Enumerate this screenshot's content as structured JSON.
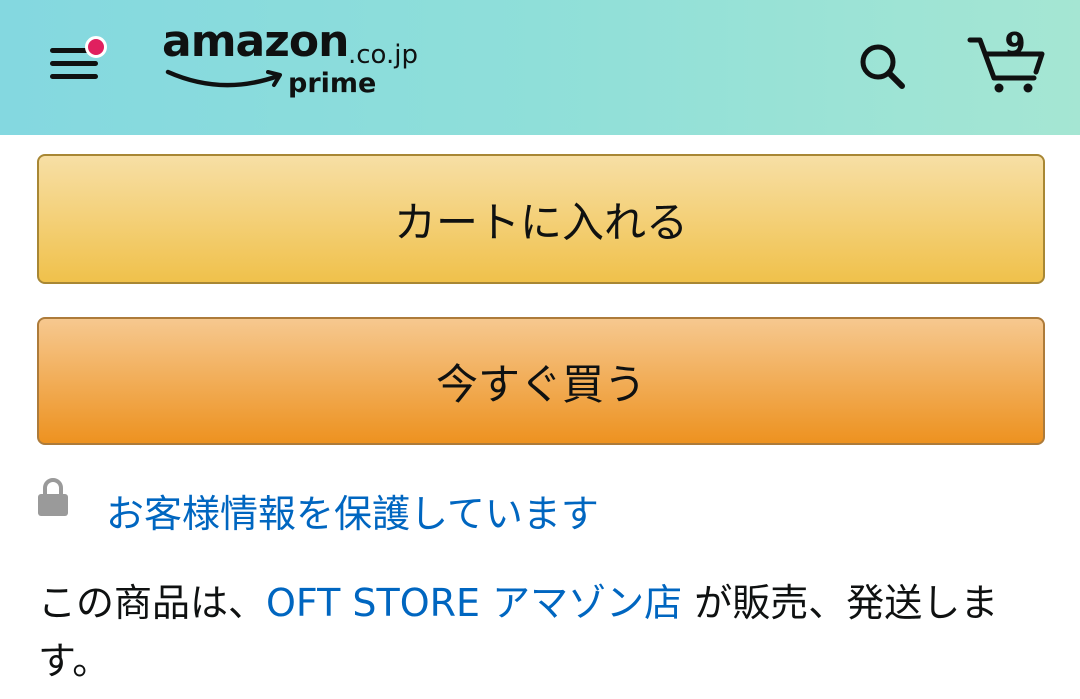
{
  "header": {
    "logo_word": "amazon",
    "logo_tld": ".co.jp",
    "logo_prime": "prime",
    "cart_count": "9",
    "colors": {
      "gradient_start": "#84d8e0",
      "gradient_end": "#a5e6d3",
      "notification_dot": "#e0205f"
    },
    "icons": {
      "menu": "hamburger-menu-icon",
      "search": "search-icon",
      "cart": "cart-icon"
    }
  },
  "actions": {
    "add_to_cart_label": "カートに入れる",
    "buy_now_label": "今すぐ買う",
    "colors": {
      "add_to_cart": "#f0c14b",
      "buy_now": "#ed9220"
    }
  },
  "secure": {
    "icon": "lock-icon",
    "text": "お客様情報を保護しています",
    "color": "#0066c0"
  },
  "seller": {
    "prefix": "この商品は、",
    "seller_name": "OFT STORE アマゾン店",
    "suffix": " が販売、発送します。"
  }
}
